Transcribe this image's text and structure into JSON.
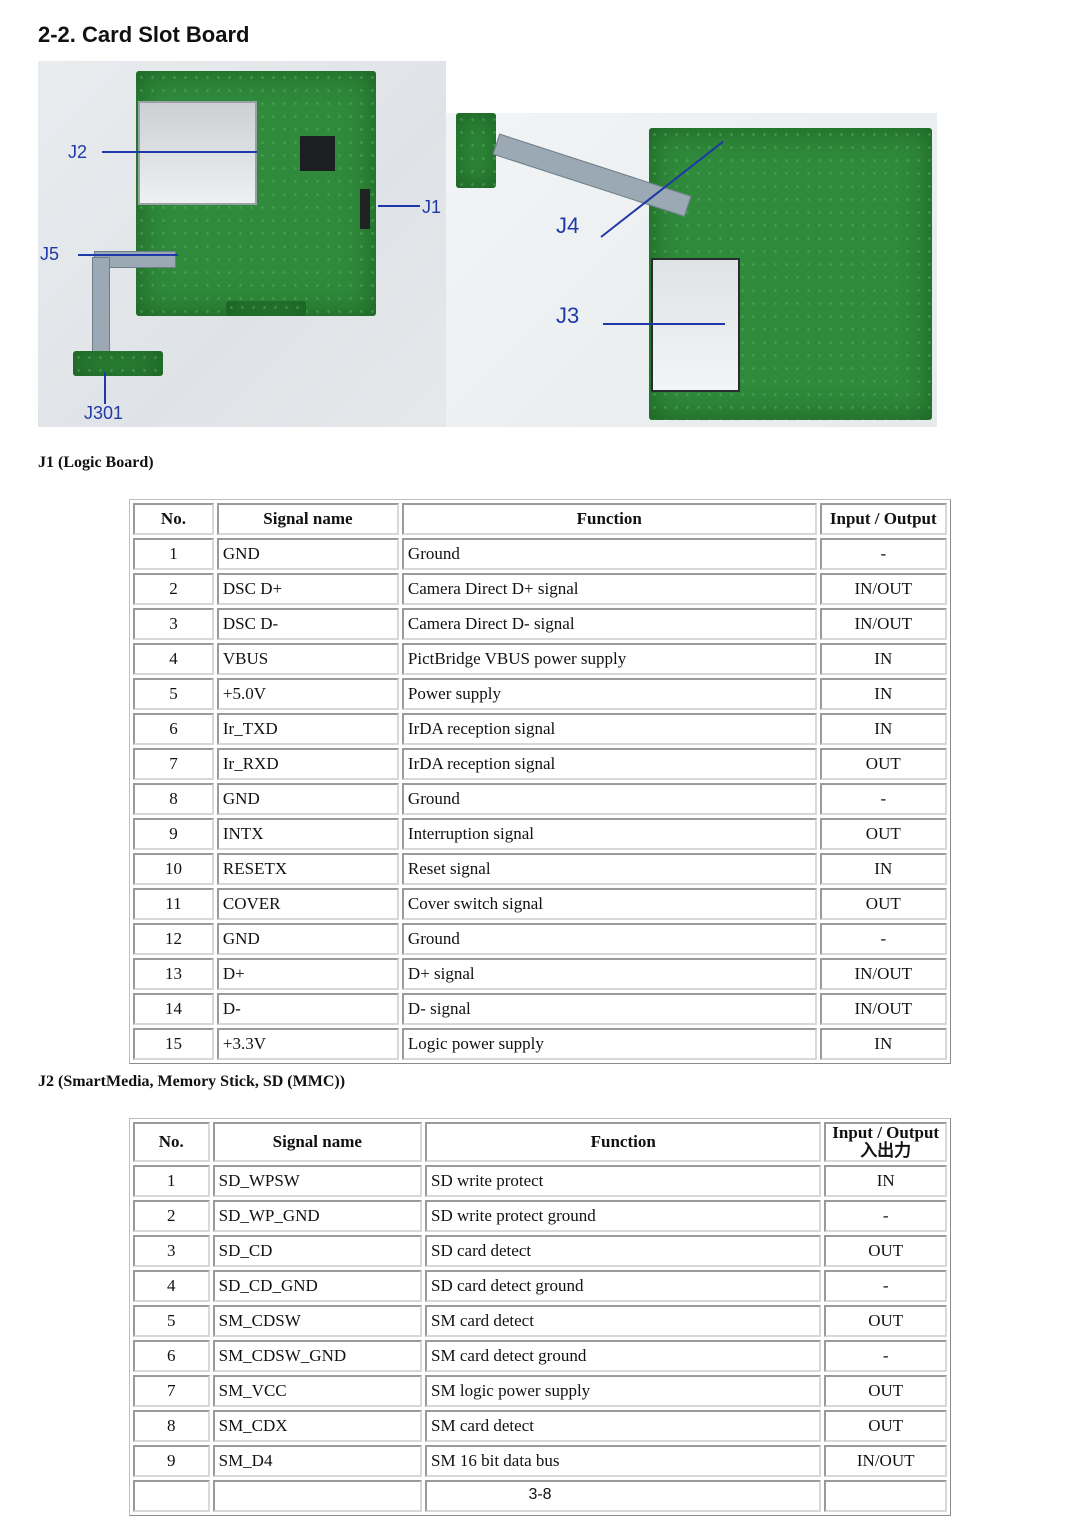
{
  "page": {
    "title": "2-2.  Card Slot Board",
    "page_number": "3-8"
  },
  "figures": {
    "board_top": {
      "callouts": [
        "J2",
        "J1",
        "J5",
        "J301"
      ]
    },
    "board_bottom": {
      "callouts": [
        "J4",
        "J3"
      ]
    },
    "callout_color": "#1f3aa8"
  },
  "j1": {
    "label": "J1 (Logic Board)",
    "headers": {
      "no": "No.",
      "signal": "Signal name",
      "function": "Function",
      "io": "Input / Output"
    },
    "rows": [
      {
        "no": "1",
        "signal": "GND",
        "function": "Ground",
        "io": "-"
      },
      {
        "no": "2",
        "signal": "DSC D+",
        "function": "Camera Direct D+ signal",
        "io": "IN/OUT"
      },
      {
        "no": "3",
        "signal": "DSC D-",
        "function": "Camera Direct D- signal",
        "io": "IN/OUT"
      },
      {
        "no": "4",
        "signal": "VBUS",
        "function": "PictBridge VBUS power supply",
        "io": "IN"
      },
      {
        "no": "5",
        "signal": "+5.0V",
        "function": "Power supply",
        "io": "IN"
      },
      {
        "no": "6",
        "signal": "Ir_TXD",
        "function": "IrDA reception signal",
        "io": "IN"
      },
      {
        "no": "7",
        "signal": "Ir_RXD",
        "function": "IrDA reception signal",
        "io": "OUT"
      },
      {
        "no": "8",
        "signal": "GND",
        "function": "Ground",
        "io": "-"
      },
      {
        "no": "9",
        "signal": "INTX",
        "function": "Interruption signal",
        "io": "OUT"
      },
      {
        "no": "10",
        "signal": "RESETX",
        "function": "Reset signal",
        "io": "IN"
      },
      {
        "no": "11",
        "signal": "COVER",
        "function": "Cover switch signal",
        "io": "OUT"
      },
      {
        "no": "12",
        "signal": "GND",
        "function": "Ground",
        "io": "-"
      },
      {
        "no": "13",
        "signal": "D+",
        "function": "D+ signal",
        "io": "IN/OUT"
      },
      {
        "no": "14",
        "signal": "D-",
        "function": "D- signal",
        "io": "IN/OUT"
      },
      {
        "no": "15",
        "signal": "+3.3V",
        "function": "Logic power supply",
        "io": "IN"
      }
    ]
  },
  "j2": {
    "label": "J2 (SmartMedia, Memory Stick, SD (MMC))",
    "headers": {
      "no": "No.",
      "signal": "Signal name",
      "function": "Function",
      "io": "Input / Output",
      "io_sub": "入出力"
    },
    "rows": [
      {
        "no": "1",
        "signal": "SD_WPSW",
        "function": "SD write protect",
        "io": "IN"
      },
      {
        "no": "2",
        "signal": "SD_WP_GND",
        "function": "SD write protect ground",
        "io": "-"
      },
      {
        "no": "3",
        "signal": "SD_CD",
        "function": "SD card detect",
        "io": "OUT"
      },
      {
        "no": "4",
        "signal": "SD_CD_GND",
        "function": "SD card detect ground",
        "io": "-"
      },
      {
        "no": "5",
        "signal": "SM_CDSW",
        "function": "SM card detect",
        "io": "OUT"
      },
      {
        "no": "6",
        "signal": "SM_CDSW_GND",
        "function": "SM card detect ground",
        "io": "-"
      },
      {
        "no": "7",
        "signal": "SM_VCC",
        "function": "SM logic power supply",
        "io": "OUT"
      },
      {
        "no": "8",
        "signal": "SM_CDX",
        "function": "SM card detect",
        "io": "OUT"
      },
      {
        "no": "9",
        "signal": "SM_D4",
        "function": "SM 16 bit data bus",
        "io": "IN/OUT"
      }
    ]
  }
}
